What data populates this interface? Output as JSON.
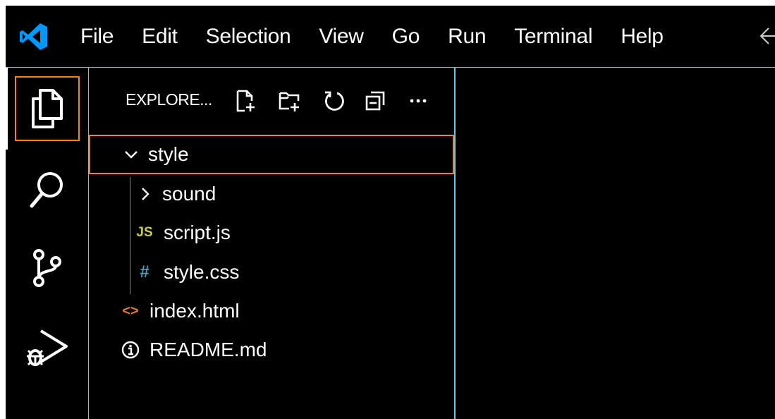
{
  "menu": {
    "items": [
      "File",
      "Edit",
      "Selection",
      "View",
      "Go",
      "Run",
      "Terminal",
      "Help"
    ]
  },
  "icons": {
    "logo": "vscode-logo",
    "back": "arrow-left-icon",
    "activity": [
      "explorer-icon",
      "search-icon",
      "source-control-icon",
      "run-debug-icon"
    ],
    "explorer_actions": [
      "new-file-icon",
      "new-folder-icon",
      "refresh-icon",
      "collapse-all-icon",
      "more-actions-icon"
    ]
  },
  "explorer": {
    "title": "EXPLORE...",
    "tree": {
      "style_folder": "style",
      "sound_folder": "sound",
      "script_file": "script.js",
      "script_badge": "JS",
      "stylecss_file": "style.css",
      "stylecss_badge": "#",
      "index_file": "index.html",
      "index_badge": "<>",
      "readme_file": "README.md"
    }
  },
  "colors": {
    "focus_border": "#f38518",
    "contrast_border": "#6fc3df",
    "js_badge": "#cbcb41",
    "css_badge": "#519aba",
    "html_badge": "#e37933",
    "vscode_blue": "#0098ff"
  }
}
